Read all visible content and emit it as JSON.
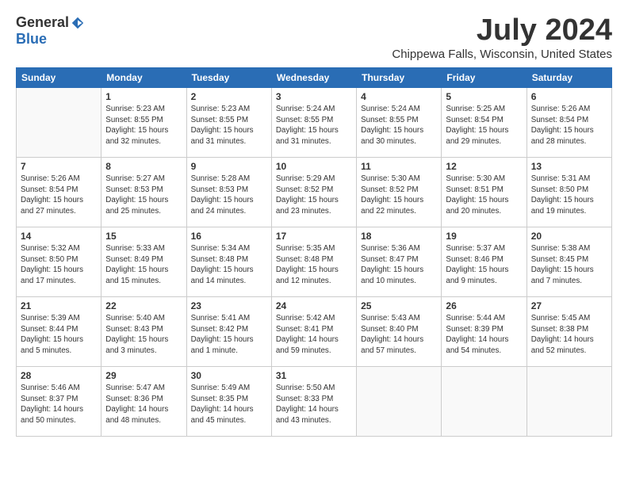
{
  "logo": {
    "general": "General",
    "blue": "Blue"
  },
  "title": "July 2024",
  "location": "Chippewa Falls, Wisconsin, United States",
  "weekdays": [
    "Sunday",
    "Monday",
    "Tuesday",
    "Wednesday",
    "Thursday",
    "Friday",
    "Saturday"
  ],
  "weeks": [
    [
      {
        "date": "",
        "info": ""
      },
      {
        "date": "1",
        "info": "Sunrise: 5:23 AM\nSunset: 8:55 PM\nDaylight: 15 hours\nand 32 minutes."
      },
      {
        "date": "2",
        "info": "Sunrise: 5:23 AM\nSunset: 8:55 PM\nDaylight: 15 hours\nand 31 minutes."
      },
      {
        "date": "3",
        "info": "Sunrise: 5:24 AM\nSunset: 8:55 PM\nDaylight: 15 hours\nand 31 minutes."
      },
      {
        "date": "4",
        "info": "Sunrise: 5:24 AM\nSunset: 8:55 PM\nDaylight: 15 hours\nand 30 minutes."
      },
      {
        "date": "5",
        "info": "Sunrise: 5:25 AM\nSunset: 8:54 PM\nDaylight: 15 hours\nand 29 minutes."
      },
      {
        "date": "6",
        "info": "Sunrise: 5:26 AM\nSunset: 8:54 PM\nDaylight: 15 hours\nand 28 minutes."
      }
    ],
    [
      {
        "date": "7",
        "info": "Sunrise: 5:26 AM\nSunset: 8:54 PM\nDaylight: 15 hours\nand 27 minutes."
      },
      {
        "date": "8",
        "info": "Sunrise: 5:27 AM\nSunset: 8:53 PM\nDaylight: 15 hours\nand 25 minutes."
      },
      {
        "date": "9",
        "info": "Sunrise: 5:28 AM\nSunset: 8:53 PM\nDaylight: 15 hours\nand 24 minutes."
      },
      {
        "date": "10",
        "info": "Sunrise: 5:29 AM\nSunset: 8:52 PM\nDaylight: 15 hours\nand 23 minutes."
      },
      {
        "date": "11",
        "info": "Sunrise: 5:30 AM\nSunset: 8:52 PM\nDaylight: 15 hours\nand 22 minutes."
      },
      {
        "date": "12",
        "info": "Sunrise: 5:30 AM\nSunset: 8:51 PM\nDaylight: 15 hours\nand 20 minutes."
      },
      {
        "date": "13",
        "info": "Sunrise: 5:31 AM\nSunset: 8:50 PM\nDaylight: 15 hours\nand 19 minutes."
      }
    ],
    [
      {
        "date": "14",
        "info": "Sunrise: 5:32 AM\nSunset: 8:50 PM\nDaylight: 15 hours\nand 17 minutes."
      },
      {
        "date": "15",
        "info": "Sunrise: 5:33 AM\nSunset: 8:49 PM\nDaylight: 15 hours\nand 15 minutes."
      },
      {
        "date": "16",
        "info": "Sunrise: 5:34 AM\nSunset: 8:48 PM\nDaylight: 15 hours\nand 14 minutes."
      },
      {
        "date": "17",
        "info": "Sunrise: 5:35 AM\nSunset: 8:48 PM\nDaylight: 15 hours\nand 12 minutes."
      },
      {
        "date": "18",
        "info": "Sunrise: 5:36 AM\nSunset: 8:47 PM\nDaylight: 15 hours\nand 10 minutes."
      },
      {
        "date": "19",
        "info": "Sunrise: 5:37 AM\nSunset: 8:46 PM\nDaylight: 15 hours\nand 9 minutes."
      },
      {
        "date": "20",
        "info": "Sunrise: 5:38 AM\nSunset: 8:45 PM\nDaylight: 15 hours\nand 7 minutes."
      }
    ],
    [
      {
        "date": "21",
        "info": "Sunrise: 5:39 AM\nSunset: 8:44 PM\nDaylight: 15 hours\nand 5 minutes."
      },
      {
        "date": "22",
        "info": "Sunrise: 5:40 AM\nSunset: 8:43 PM\nDaylight: 15 hours\nand 3 minutes."
      },
      {
        "date": "23",
        "info": "Sunrise: 5:41 AM\nSunset: 8:42 PM\nDaylight: 15 hours\nand 1 minute."
      },
      {
        "date": "24",
        "info": "Sunrise: 5:42 AM\nSunset: 8:41 PM\nDaylight: 14 hours\nand 59 minutes."
      },
      {
        "date": "25",
        "info": "Sunrise: 5:43 AM\nSunset: 8:40 PM\nDaylight: 14 hours\nand 57 minutes."
      },
      {
        "date": "26",
        "info": "Sunrise: 5:44 AM\nSunset: 8:39 PM\nDaylight: 14 hours\nand 54 minutes."
      },
      {
        "date": "27",
        "info": "Sunrise: 5:45 AM\nSunset: 8:38 PM\nDaylight: 14 hours\nand 52 minutes."
      }
    ],
    [
      {
        "date": "28",
        "info": "Sunrise: 5:46 AM\nSunset: 8:37 PM\nDaylight: 14 hours\nand 50 minutes."
      },
      {
        "date": "29",
        "info": "Sunrise: 5:47 AM\nSunset: 8:36 PM\nDaylight: 14 hours\nand 48 minutes."
      },
      {
        "date": "30",
        "info": "Sunrise: 5:49 AM\nSunset: 8:35 PM\nDaylight: 14 hours\nand 45 minutes."
      },
      {
        "date": "31",
        "info": "Sunrise: 5:50 AM\nSunset: 8:33 PM\nDaylight: 14 hours\nand 43 minutes."
      },
      {
        "date": "",
        "info": ""
      },
      {
        "date": "",
        "info": ""
      },
      {
        "date": "",
        "info": ""
      }
    ]
  ]
}
